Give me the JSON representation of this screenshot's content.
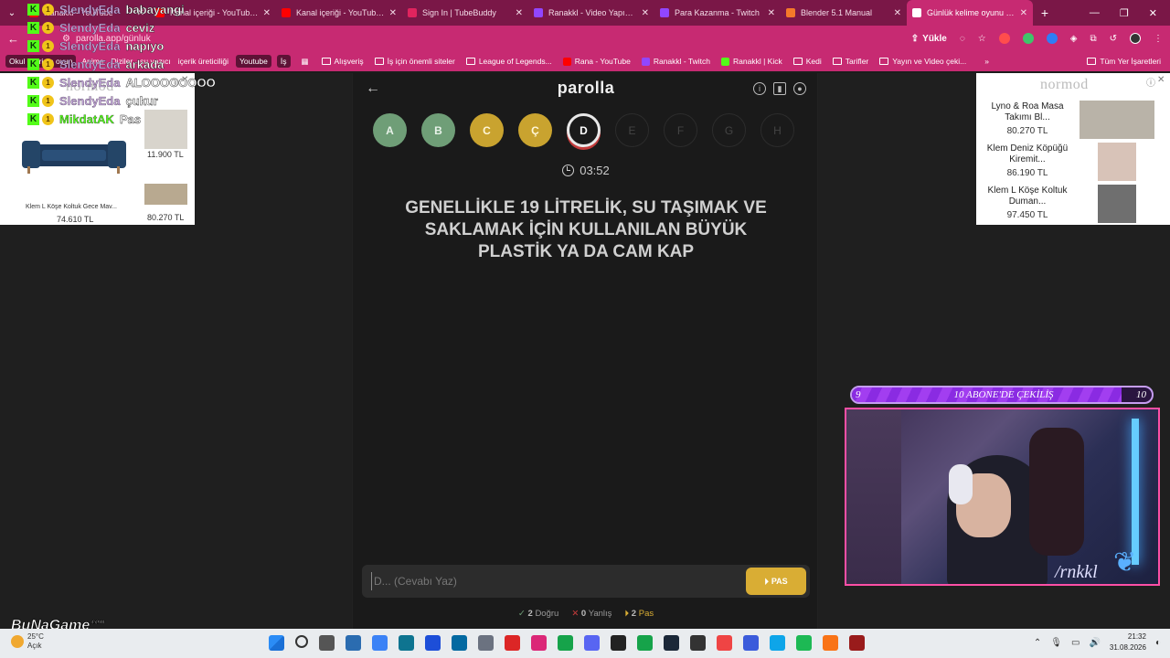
{
  "browser": {
    "tabs": [
      {
        "title": "Ranakkl - YouTube",
        "color": "#ff0000",
        "active": false
      },
      {
        "title": "Kanal içeriği - YouTube Stu",
        "color": "#ff0000",
        "active": false
      },
      {
        "title": "Kanal içeriği - YouTube Stu",
        "color": "#ff0000",
        "active": false
      },
      {
        "title": "Sign In | TubeBuddy",
        "color": "#e0245e",
        "active": false
      },
      {
        "title": "Ranakkl - Video Yapımcısı",
        "color": "#9146ff",
        "active": false
      },
      {
        "title": "Para Kazanma - Twitch",
        "color": "#9146ff",
        "active": false
      },
      {
        "title": "Blender 5.1 Manual",
        "color": "#f5792a",
        "active": false
      },
      {
        "title": "Günlük kelime oyunu - pa",
        "color": "#ffffff",
        "active": true
      }
    ],
    "new_tab": "+",
    "omnibox_text": "parolla.app/günluk",
    "upload_label": "Yükle",
    "bookmarks": [
      {
        "label": "Okul işleri ve oyun",
        "chip": true
      },
      {
        "label": "Anime",
        "chip": false
      },
      {
        "label": "Diziler",
        "chip": false
      },
      {
        "label": "su yazıcı",
        "chip": false
      },
      {
        "label": "içerik üreticiliği",
        "chip": false
      },
      {
        "label": "Youtube",
        "chip": true
      },
      {
        "label": "İş",
        "chip": true
      }
    ],
    "bookmark_folders": [
      {
        "label": "Alışveriş",
        "type": "folder"
      },
      {
        "label": "İş için önemli siteler",
        "type": "folder"
      },
      {
        "label": "League of Legends...",
        "type": "folder"
      },
      {
        "label": "Rana - YouTube",
        "type": "yt"
      },
      {
        "label": "Ranakkl - Twitch",
        "type": "twitch"
      },
      {
        "label": "Ranakkl | Kick",
        "type": "kick"
      },
      {
        "label": "Kedi",
        "type": "folder"
      },
      {
        "label": "Tarifler",
        "type": "folder"
      },
      {
        "label": "Yayın ve Video çeki...",
        "type": "folder"
      }
    ],
    "bookmark_more": "»",
    "all_bookmarks": "Tüm Yer İşaretleri"
  },
  "left_ad": {
    "brand": "normod",
    "main_product": "Klem L Köşe Koltuk Gece Mav...",
    "main_price": "74.610 TL",
    "side_prices": [
      "11.900 TL",
      "80.270 TL"
    ]
  },
  "right_ad": {
    "brand": "normod",
    "items": [
      {
        "name": "Lyno & Roa Masa Takımı Bl...",
        "price": "80.270 TL"
      },
      {
        "name": "Klem Deniz Köpüğü Kiremit...",
        "price": "86.190 TL"
      },
      {
        "name": "Klem L Köşe Koltuk Duman...",
        "price": "97.450 TL"
      }
    ]
  },
  "game": {
    "logo": "parolla",
    "letters": [
      {
        "letter": "A",
        "state": "correct"
      },
      {
        "letter": "B",
        "state": "correct"
      },
      {
        "letter": "C",
        "state": "pass"
      },
      {
        "letter": "Ç",
        "state": "pass"
      },
      {
        "letter": "D",
        "state": "current"
      },
      {
        "letter": "E",
        "state": "pending"
      },
      {
        "letter": "F",
        "state": "pending"
      },
      {
        "letter": "G",
        "state": "pending"
      },
      {
        "letter": "H",
        "state": "pending"
      }
    ],
    "timer": "03:52",
    "question": "GENELLİKLE 19 LİTRELİK, SU TAŞIMAK VE SAKLAMAK İÇİN KULLANILAN BÜYÜK PLASTİK YA DA CAM KAP",
    "answer_placeholder": "D... (Cevabı Yaz)",
    "pass_label": "PAS",
    "stats": {
      "correct_count": "2",
      "correct_label": "Doğru",
      "wrong_count": "0",
      "wrong_label": "Yanlış",
      "pass_count": "2",
      "pass_label": "Pas"
    },
    "colors": {
      "correct": "#6f9e77",
      "pass": "#c9a32f",
      "wrong": "#c23b3b"
    }
  },
  "chat": [
    {
      "user": "SlendyEda",
      "msg": "babayangi",
      "user_green": false
    },
    {
      "user": "SlendyEda",
      "msg": "ceviz",
      "user_green": false
    },
    {
      "user": "SlendyEda",
      "msg": "napıyo",
      "user_green": false
    },
    {
      "user": "SlendyEda",
      "msg": "arkada",
      "user_green": false
    },
    {
      "user": "SlendyEda",
      "msg": "ALOOOOOOOO",
      "user_green": false
    },
    {
      "user": "SlendyEda",
      "msg": "çukur",
      "user_green": false
    },
    {
      "user": "MikdatAK",
      "msg": "Pas",
      "user_green": true
    }
  ],
  "giveaway": {
    "label": "10 ABONE'DE ÇEKİLİŞ",
    "current": "9",
    "goal": "10",
    "progress": 0.9
  },
  "webcam": {
    "handle": "/rnkkl"
  },
  "watermark": {
    "text": "BuNaGame",
    "suffix": ".com"
  },
  "taskbar": {
    "temperature": "25°C",
    "weather_desc": "Açık",
    "time": "21:32",
    "date": "31.08.2026",
    "apps": [
      "windows",
      "search",
      "task-view",
      "app1",
      "app2",
      "app3",
      "app4",
      "app5",
      "settings",
      "app6",
      "instagram",
      "chrome",
      "discord",
      "obs",
      "xbox",
      "steam",
      "epic",
      "app7",
      "ea",
      "app8",
      "spotify",
      "app9",
      "app10"
    ]
  }
}
